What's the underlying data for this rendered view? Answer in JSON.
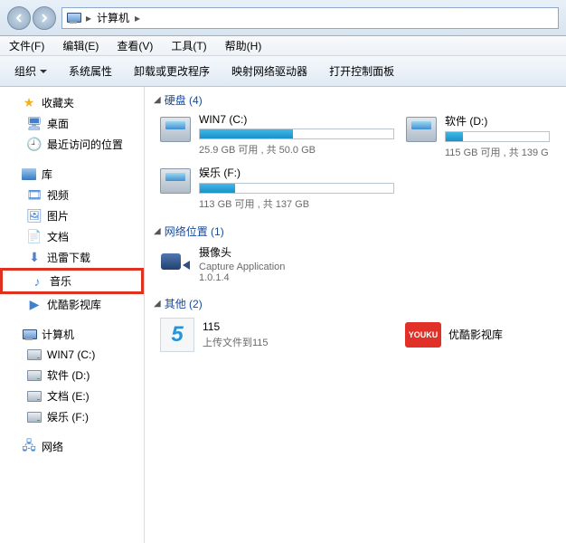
{
  "breadcrumb": {
    "root": "计算机"
  },
  "menubar": [
    {
      "label": "文件(F)"
    },
    {
      "label": "编辑(E)"
    },
    {
      "label": "查看(V)"
    },
    {
      "label": "工具(T)"
    },
    {
      "label": "帮助(H)"
    }
  ],
  "toolbar": {
    "organize": "组织",
    "sysprops": "系统属性",
    "uninstall": "卸载或更改程序",
    "mapnet": "映射网络驱动器",
    "controlpanel": "打开控制面板"
  },
  "sidebar": {
    "favorites": {
      "title": "收藏夹",
      "items": [
        "桌面",
        "最近访问的位置"
      ]
    },
    "libraries": {
      "title": "库",
      "items": [
        "视频",
        "图片",
        "文档",
        "迅雷下载",
        "音乐",
        "优酷影视库"
      ]
    },
    "computer": {
      "title": "计算机",
      "items": [
        "WIN7 (C:)",
        "软件 (D:)",
        "文档 (E:)",
        "娱乐 (F:)"
      ]
    },
    "network": {
      "title": "网络"
    }
  },
  "main": {
    "drives": {
      "header": "硬盘 (4)",
      "items": [
        {
          "name": "WIN7 (C:)",
          "fill": 48,
          "stat": "25.9 GB 可用 , 共 50.0 GB"
        },
        {
          "name": "软件 (D:)",
          "fill": 17,
          "stat": "115 GB 可用 , 共 139 G"
        },
        {
          "name": "娱乐 (F:)",
          "fill": 18,
          "stat": "113 GB 可用 , 共 137 GB"
        }
      ]
    },
    "netloc": {
      "header": "网络位置 (1)",
      "items": [
        {
          "name": "摄像头",
          "sub1": "Capture Application",
          "sub2": "1.0.1.4"
        }
      ]
    },
    "other": {
      "header": "其他 (2)",
      "items": [
        {
          "name": "115",
          "sub": "上传文件到115",
          "icon": "115"
        },
        {
          "name": "优酷影视库",
          "sub": "",
          "icon": "youku",
          "youku_text": "YOUKU"
        }
      ]
    }
  }
}
